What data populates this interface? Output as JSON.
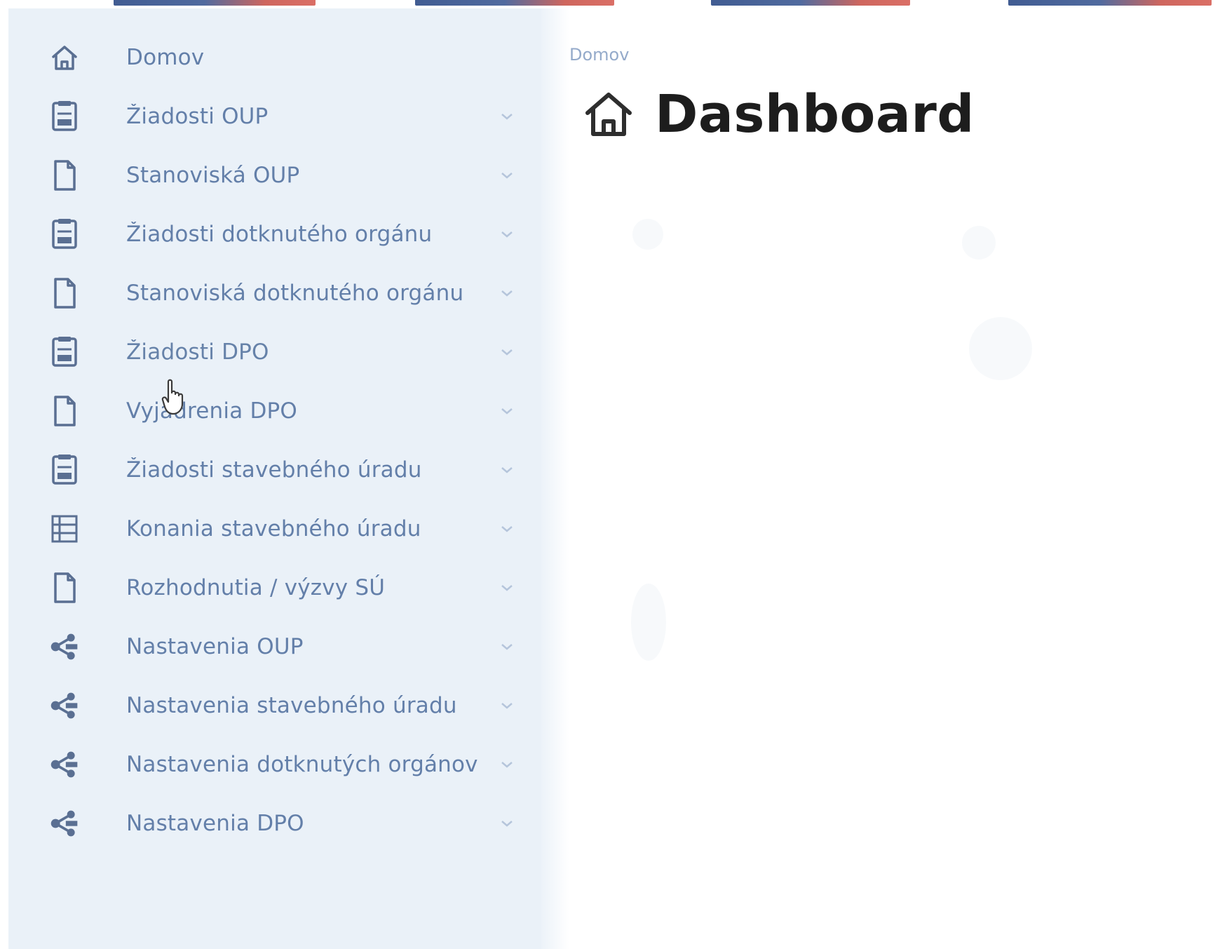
{
  "breadcrumb": "Domov",
  "page": {
    "title": "Dashboard"
  },
  "sidebar": {
    "items": [
      {
        "label": "Domov",
        "icon": "home-icon",
        "has_chevron": false
      },
      {
        "label": "Žiadosti OUP",
        "icon": "document-list-icon",
        "has_chevron": true
      },
      {
        "label": "Stanoviská OUP",
        "icon": "document-icon",
        "has_chevron": true
      },
      {
        "label": "Žiadosti dotknutého orgánu",
        "icon": "document-list-icon",
        "has_chevron": true
      },
      {
        "label": "Stanoviská dotknutého orgánu",
        "icon": "document-icon",
        "has_chevron": true
      },
      {
        "label": "Žiadosti DPO",
        "icon": "document-list-icon",
        "has_chevron": true
      },
      {
        "label": "Vyjadrenia DPO",
        "icon": "document-icon",
        "has_chevron": true
      },
      {
        "label": "Žiadosti stavebného úradu",
        "icon": "document-list-icon",
        "has_chevron": true
      },
      {
        "label": "Konania stavebného úradu",
        "icon": "list-icon",
        "has_chevron": true
      },
      {
        "label": "Rozhodnutia / výzvy SÚ",
        "icon": "document-icon",
        "has_chevron": true
      },
      {
        "label": "Nastavenia OUP",
        "icon": "settings-share-icon",
        "has_chevron": true
      },
      {
        "label": "Nastavenia stavebného úradu",
        "icon": "settings-share-icon",
        "has_chevron": true
      },
      {
        "label": "Nastavenia dotknutých orgánov",
        "icon": "settings-share-icon",
        "has_chevron": true
      },
      {
        "label": "Nastavenia DPO",
        "icon": "settings-share-icon",
        "has_chevron": true
      }
    ]
  },
  "colors": {
    "sidebar_bg": "#eaf1f8",
    "nav_text": "#4c6c9c",
    "title_text": "#1d1d1d",
    "stripe_start": "#2c4a86",
    "stripe_end": "#d65f55"
  }
}
